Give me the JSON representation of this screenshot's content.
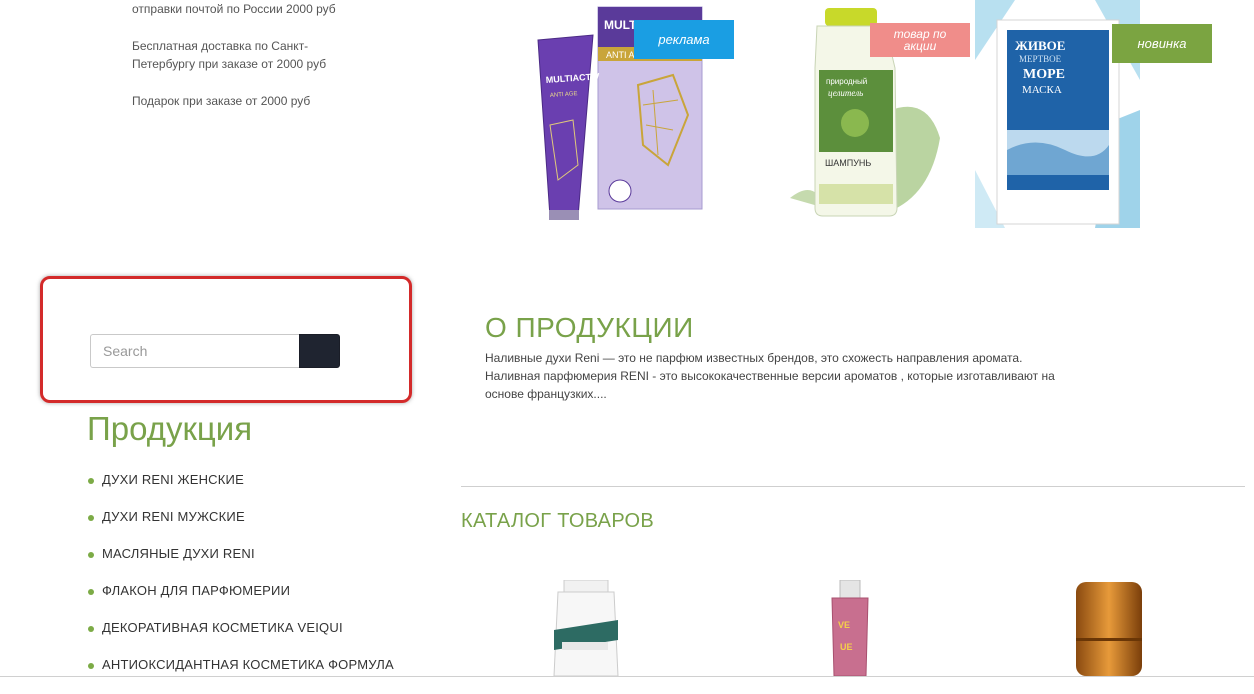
{
  "shipping_info": {
    "line1": "отправки почтой по России 2000 руб",
    "line2": "Бесплатная доставка по Санкт-Петербургу при заказе от 2000 руб",
    "line3": "Подарок при заказе от 2000 руб"
  },
  "featured": [
    {
      "badge": "реклама",
      "badge_color": "#1a9ee3",
      "product": "Multiactiv Anti Age"
    },
    {
      "badge": "товар по акции",
      "badge_color": "#f08d8a",
      "product": "Природный целитель шампунь"
    },
    {
      "badge": "новинка",
      "badge_color": "#7ba441",
      "product": "Живое Мертвое Море маска для ног"
    }
  ],
  "search": {
    "placeholder": "Search",
    "value": ""
  },
  "sidebar": {
    "title": "Продукция",
    "items": [
      "ДУХИ RENI ЖЕНСКИЕ",
      "ДУХИ RENI МУЖСКИЕ",
      "МАСЛЯНЫЕ ДУХИ RENI",
      "ФЛАКОН ДЛЯ ПАРФЮМЕРИИ",
      "ДЕКОРАТИВНАЯ КОСМЕТИКА VEIQUI",
      "АНТИОКСИДАНТНАЯ КОСМЕТИКА ФОРМУЛА"
    ]
  },
  "about": {
    "title": "О ПРОДУКЦИИ",
    "text": "Наливные духи Reni — это не парфюм известных брендов, это схожесть направления аромата. Наливная парфюмерия RENI - это высококачественные версии ароматов , которые изготавливают на основе французких...."
  },
  "catalog": {
    "title": "КАТАЛОГ ТОВАРОВ"
  },
  "colors": {
    "accent_green": "#79a24a",
    "search_frame": "#d32a2a",
    "search_button": "#1f2430"
  }
}
